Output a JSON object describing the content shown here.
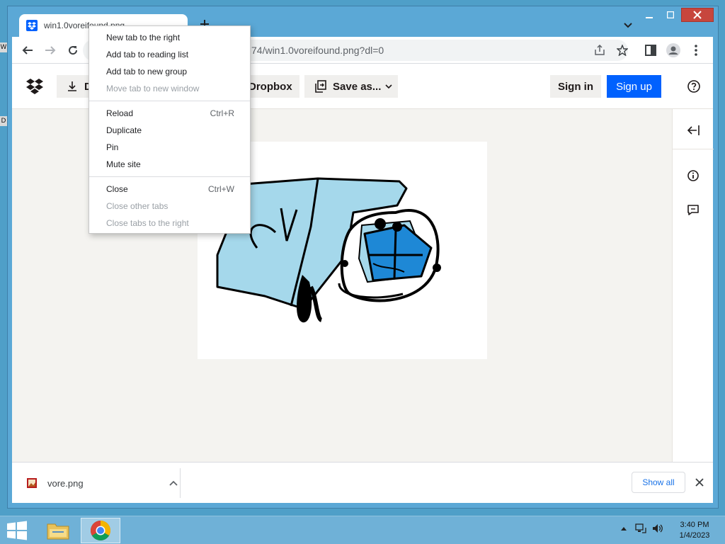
{
  "window": {
    "tab": {
      "title": "win1.0voreifound.png"
    },
    "address": {
      "url": "74/win1.0voreifound.png?dl=0"
    }
  },
  "dropbox": {
    "download_label": "D",
    "open_in_dropbox_label": "Dropbox",
    "save_as_label": "Save as...",
    "sign_in_label": "Sign in",
    "sign_up_label": "Sign up"
  },
  "context_menu": {
    "items": [
      {
        "label": "New tab to the right",
        "shortcut": "",
        "disabled": false
      },
      {
        "label": "Add tab to reading list",
        "shortcut": "",
        "disabled": false
      },
      {
        "label": "Add tab to new group",
        "shortcut": "",
        "disabled": false
      },
      {
        "label": "Move tab to new window",
        "shortcut": "",
        "disabled": true
      },
      {
        "label": "Reload",
        "shortcut": "Ctrl+R",
        "disabled": false
      },
      {
        "label": "Duplicate",
        "shortcut": "",
        "disabled": false
      },
      {
        "label": "Pin",
        "shortcut": "",
        "disabled": false
      },
      {
        "label": "Mute site",
        "shortcut": "",
        "disabled": false
      },
      {
        "label": "Close",
        "shortcut": "Ctrl+W",
        "disabled": false
      },
      {
        "label": "Close other tabs",
        "shortcut": "",
        "disabled": true
      },
      {
        "label": "Close tabs to the right",
        "shortcut": "",
        "disabled": true
      }
    ]
  },
  "download_shelf": {
    "file_name": "vore.png",
    "show_all_label": "Show all"
  },
  "taskbar": {
    "time": "3:40 PM",
    "date": "1/4/2023"
  },
  "desktop": {
    "glyph_1": "W",
    "glyph_2": "D"
  },
  "colors": {
    "dropbox_blue": "#0061fe",
    "taskbar": "#6fb1d7",
    "window_frame": "#5ba8d6",
    "close_button": "#c7463d"
  }
}
